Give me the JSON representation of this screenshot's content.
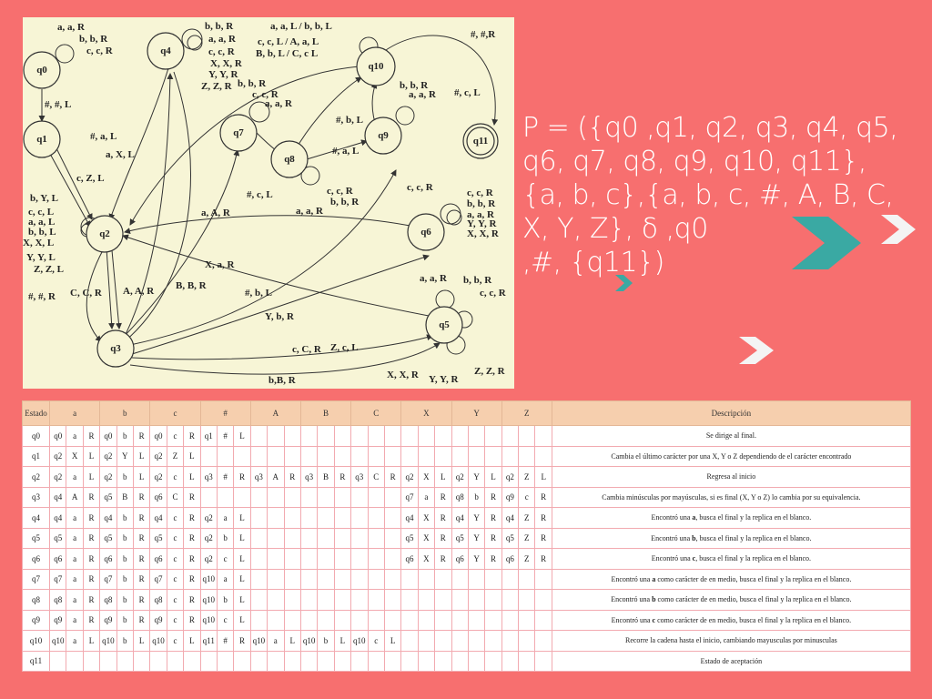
{
  "diagram": {
    "states": [
      "q0",
      "q1",
      "q2",
      "q3",
      "q4",
      "q5",
      "q6",
      "q7",
      "q8",
      "q9",
      "q10",
      "q11"
    ],
    "final_state": "q11",
    "labels": {
      "q0_loop": [
        "a, a, R",
        "b, b, R",
        "c, c, R"
      ],
      "q0_q1": "#, #, L",
      "q1_q2_a": "#, a, L",
      "q1_q2_b": "a, X, L",
      "q1_q2_c": "c, Z, L",
      "q1_q2_d": "b, Y, L",
      "q2_loop": [
        "c, c, L",
        "a, a, L",
        "b, b, L",
        "X, X, L",
        "Y, Y, L",
        "Z, Z, L"
      ],
      "q2_q3_hash": "#, #, R",
      "q2_q3_c": "C, C, R",
      "q2_q3_a": "A, A, R",
      "q2_q3_b": "B, B, R",
      "q4_loop": [
        "b, b, R",
        "a, a, R",
        "c, c, R",
        "X, X, R",
        "Y, Y, R",
        "Z, Z, R"
      ],
      "q10_loop": [
        "a, a, L / b, b, L",
        "c, c, L / A, a, L",
        "B, b, L / C, c L"
      ],
      "q10_q11": "#, #,R",
      "q10_q2": "#, c, L",
      "q7_loop": [
        "b, b, R",
        "c, c, R",
        "a, a, R"
      ],
      "q9_loop": [
        "b, b, R",
        "a, a, R"
      ],
      "q8_q10": "#, b, L",
      "q8_q9": "#, a, L",
      "q8_loop": [
        "c, c, R",
        "b, b, R",
        "a, a, R"
      ],
      "q6_loop": [
        "c, c, R",
        "b, b, R",
        "a, a, R",
        "Y, Y, R",
        "X, X, R"
      ],
      "q3_q7": "a, A, R",
      "q2_q5": "X, a, R",
      "q5_q2_b": "#, b, L",
      "q3_q6": "Y, b, R",
      "q3_q9": "c, c, R",
      "q5_loop": [
        "a, a, R",
        "b, b, R",
        "c, c, R"
      ],
      "q3_q5_a": "c, C, R",
      "q3_q5_b": "Z, c, L",
      "q3_q5_c": "b,B, R",
      "q5_loop2": [
        "X, X, R",
        "Y, Y, R",
        "Z, Z, R"
      ]
    }
  },
  "definition": {
    "lines": [
      "P = ({q0 ,q1, q2, q3, q4, q5,",
      "q6, q7, q8, q9, q10, q11},",
      "{a, b, c},{a, b, c, #, A, B, C,",
      "X, Y, Z}, δ ,q0",
      ",#, {q11})"
    ]
  },
  "colors": {
    "background": "#f76f6f",
    "diagram_bg": "#f7f5d6",
    "teal": "#3aa9a3",
    "table_header": "#f6cfae"
  },
  "table": {
    "headers": [
      "Estado",
      "a",
      "b",
      "c",
      "#",
      "A",
      "B",
      "C",
      "X",
      "Y",
      "Z",
      "Descripción"
    ],
    "rows": [
      {
        "state": "q0",
        "cells": [
          [
            "q0",
            "a",
            "R"
          ],
          [
            "q0",
            "b",
            "R"
          ],
          [
            "q0",
            "c",
            "R"
          ],
          [
            "q1",
            "#",
            "L"
          ],
          [
            "",
            "",
            ""
          ],
          [
            "",
            "",
            ""
          ],
          [
            "",
            "",
            ""
          ],
          [
            "",
            "",
            ""
          ],
          [
            "",
            "",
            ""
          ],
          [
            "",
            "",
            ""
          ]
        ],
        "desc": "Se dirige al final."
      },
      {
        "state": "q1",
        "cells": [
          [
            "q2",
            "X",
            "L"
          ],
          [
            "q2",
            "Y",
            "L"
          ],
          [
            "q2",
            "Z",
            "L"
          ],
          [
            "",
            "",
            ""
          ],
          [
            "",
            "",
            ""
          ],
          [
            "",
            "",
            ""
          ],
          [
            "",
            "",
            ""
          ],
          [
            "",
            "",
            ""
          ],
          [
            "",
            "",
            ""
          ],
          [
            "",
            "",
            ""
          ]
        ],
        "desc": "Cambia el último carácter por una X, Y o Z dependiendo de el carácter encontrado"
      },
      {
        "state": "q2",
        "cells": [
          [
            "q2",
            "a",
            "L"
          ],
          [
            "q2",
            "b",
            "L"
          ],
          [
            "q2",
            "c",
            "L"
          ],
          [
            "q3",
            "#",
            "R"
          ],
          [
            "q3",
            "A",
            "R"
          ],
          [
            "q3",
            "B",
            "R"
          ],
          [
            "q3",
            "C",
            "R"
          ],
          [
            "q2",
            "X",
            "L"
          ],
          [
            "q2",
            "Y",
            "L"
          ],
          [
            "q2",
            "Z",
            "L"
          ]
        ],
        "desc": "Regresa al inicio"
      },
      {
        "state": "q3",
        "cells": [
          [
            "q4",
            "A",
            "R"
          ],
          [
            "q5",
            "B",
            "R"
          ],
          [
            "q6",
            "C",
            "R"
          ],
          [
            "",
            "",
            ""
          ],
          [
            "",
            "",
            ""
          ],
          [
            "",
            "",
            ""
          ],
          [
            "",
            "",
            ""
          ],
          [
            "q7",
            "a",
            "R"
          ],
          [
            "q8",
            "b",
            "R"
          ],
          [
            "q9",
            "c",
            "R"
          ]
        ],
        "desc": "Cambia minúsculas por mayúsculas, si es final (X, Y o Z) lo cambia por su equivalencia."
      },
      {
        "state": "q4",
        "cells": [
          [
            "q4",
            "a",
            "R"
          ],
          [
            "q4",
            "b",
            "R"
          ],
          [
            "q4",
            "c",
            "R"
          ],
          [
            "q2",
            "a",
            "L"
          ],
          [
            "",
            "",
            ""
          ],
          [
            "",
            "",
            ""
          ],
          [
            "",
            "",
            ""
          ],
          [
            "q4",
            "X",
            "R"
          ],
          [
            "q4",
            "Y",
            "R"
          ],
          [
            "q4",
            "Z",
            "R"
          ]
        ],
        "desc_pre": "Encontró una ",
        "desc_bold": "a",
        "desc_post": ", busca el final y la replica en el blanco."
      },
      {
        "state": "q5",
        "cells": [
          [
            "q5",
            "a",
            "R"
          ],
          [
            "q5",
            "b",
            "R"
          ],
          [
            "q5",
            "c",
            "R"
          ],
          [
            "q2",
            "b",
            "L"
          ],
          [
            "",
            "",
            ""
          ],
          [
            "",
            "",
            ""
          ],
          [
            "",
            "",
            ""
          ],
          [
            "q5",
            "X",
            "R"
          ],
          [
            "q5",
            "Y",
            "R"
          ],
          [
            "q5",
            "Z",
            "R"
          ]
        ],
        "desc_pre": "Encontró una ",
        "desc_bold": "b",
        "desc_post": ", busca el final y la replica en el blanco."
      },
      {
        "state": "q6",
        "cells": [
          [
            "q6",
            "a",
            "R"
          ],
          [
            "q6",
            "b",
            "R"
          ],
          [
            "q6",
            "c",
            "R"
          ],
          [
            "q2",
            "c",
            "L"
          ],
          [
            "",
            "",
            ""
          ],
          [
            "",
            "",
            ""
          ],
          [
            "",
            "",
            ""
          ],
          [
            "q6",
            "X",
            "R"
          ],
          [
            "q6",
            "Y",
            "R"
          ],
          [
            "q6",
            "Z",
            "R"
          ]
        ],
        "desc_pre": "Encontró una ",
        "desc_bold": "c",
        "desc_post": ", busca el final y la replica en el blanco."
      },
      {
        "state": "q7",
        "cells": [
          [
            "q7",
            "a",
            "R"
          ],
          [
            "q7",
            "b",
            "R"
          ],
          [
            "q7",
            "c",
            "R"
          ],
          [
            "q10",
            "a",
            "L"
          ],
          [
            "",
            "",
            ""
          ],
          [
            "",
            "",
            ""
          ],
          [
            "",
            "",
            ""
          ],
          [
            "",
            "",
            ""
          ],
          [
            "",
            "",
            ""
          ],
          [
            "",
            "",
            ""
          ]
        ],
        "desc_pre": "Encontró una ",
        "desc_bold": "a",
        "desc_post": " como carácter de en medio, busca el final y la replica en el blanco."
      },
      {
        "state": "q8",
        "cells": [
          [
            "q8",
            "a",
            "R"
          ],
          [
            "q8",
            "b",
            "R"
          ],
          [
            "q8",
            "c",
            "R"
          ],
          [
            "q10",
            "b",
            "L"
          ],
          [
            "",
            "",
            ""
          ],
          [
            "",
            "",
            ""
          ],
          [
            "",
            "",
            ""
          ],
          [
            "",
            "",
            ""
          ],
          [
            "",
            "",
            ""
          ],
          [
            "",
            "",
            ""
          ]
        ],
        "desc_pre": "Encontró una ",
        "desc_bold": "b",
        "desc_post": " como carácter de en medio, busca el final y la replica en el blanco."
      },
      {
        "state": "q9",
        "cells": [
          [
            "q9",
            "a",
            "R"
          ],
          [
            "q9",
            "b",
            "R"
          ],
          [
            "q9",
            "c",
            "R"
          ],
          [
            "q10",
            "c",
            "L"
          ],
          [
            "",
            "",
            ""
          ],
          [
            "",
            "",
            ""
          ],
          [
            "",
            "",
            ""
          ],
          [
            "",
            "",
            ""
          ],
          [
            "",
            "",
            ""
          ],
          [
            "",
            "",
            ""
          ]
        ],
        "desc_pre": "Encontró una ",
        "desc_bold": "c",
        "desc_post": " como carácter de en medio, busca el final y la replica en el blanco."
      },
      {
        "state": "q10",
        "cells": [
          [
            "q10",
            "a",
            "L"
          ],
          [
            "q10",
            "b",
            "L"
          ],
          [
            "q10",
            "c",
            "L"
          ],
          [
            "q11",
            "#",
            "R"
          ],
          [
            "q10",
            "a",
            "L"
          ],
          [
            "q10",
            "b",
            "L"
          ],
          [
            "q10",
            "c",
            "L"
          ],
          [
            "",
            "",
            ""
          ],
          [
            "",
            "",
            ""
          ],
          [
            "",
            "",
            ""
          ]
        ],
        "desc": "Recorre la cadena hasta el inicio, cambiando mayusculas por minusculas"
      },
      {
        "state": "q11",
        "cells": [
          [
            "",
            "",
            ""
          ],
          [
            "",
            "",
            ""
          ],
          [
            "",
            "",
            ""
          ],
          [
            "",
            "",
            ""
          ],
          [
            "",
            "",
            ""
          ],
          [
            "",
            "",
            ""
          ],
          [
            "",
            "",
            ""
          ],
          [
            "",
            "",
            ""
          ],
          [
            "",
            "",
            ""
          ],
          [
            "",
            "",
            ""
          ]
        ],
        "desc": "Estado de aceptación"
      }
    ]
  }
}
